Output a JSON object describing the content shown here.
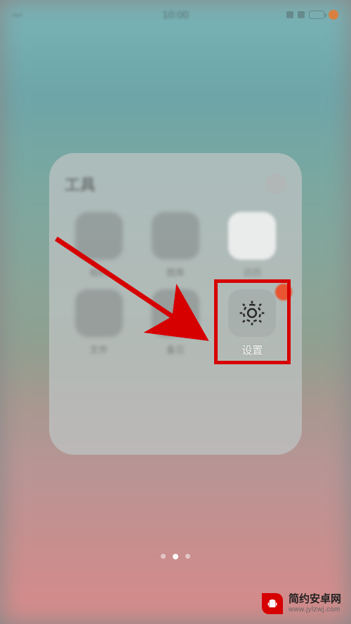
{
  "statusbar": {
    "time": "10:00"
  },
  "folder": {
    "title": "工具",
    "apps": [
      {
        "label": "相机",
        "icon": "camera"
      },
      {
        "label": "图库",
        "icon": "gallery"
      },
      {
        "label": "日历",
        "icon": "calendar"
      },
      {
        "label": "文件",
        "icon": "files"
      },
      {
        "label": "备忘",
        "icon": "notes"
      },
      {
        "label": "设置",
        "icon": "settings"
      }
    ]
  },
  "highlight": {
    "target_index": 5,
    "color": "#d60000"
  },
  "watermark": {
    "name": "简约安卓网",
    "url": "www.jylzwj.com"
  }
}
